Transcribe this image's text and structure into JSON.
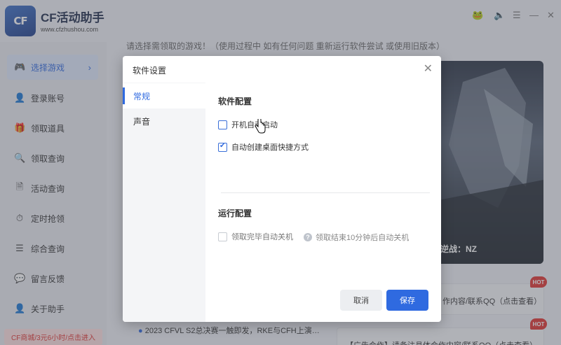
{
  "app": {
    "logo_text": "CF",
    "name": "CF活动助手",
    "url": "www.cfzhushou.com"
  },
  "window_controls": [
    "🐸",
    "🔈",
    "☰",
    "—",
    "✕"
  ],
  "sidebar": {
    "items": [
      {
        "label": "选择游戏",
        "icon": "gamepad-icon",
        "glyph": "🎮",
        "active": true
      },
      {
        "label": "登录账号",
        "icon": "user-icon",
        "glyph": "👤"
      },
      {
        "label": "领取道具",
        "icon": "gift-icon",
        "glyph": "🎁"
      },
      {
        "label": "领取查询",
        "icon": "search-gift-icon",
        "glyph": "🔍"
      },
      {
        "label": "活动查询",
        "icon": "document-search-icon",
        "glyph": "🗎"
      },
      {
        "label": "定时抢领",
        "icon": "timer-icon",
        "glyph": "⏱"
      },
      {
        "label": "综合查询",
        "icon": "list-icon",
        "glyph": "☰"
      },
      {
        "label": "留言反馈",
        "icon": "chat-icon",
        "glyph": "💬"
      },
      {
        "label": "关于助手",
        "icon": "info-user-icon",
        "glyph": "👤"
      }
    ],
    "promo": "CF商城/3元6小时/点击进入"
  },
  "main": {
    "notice": "请选择需领取的游戏！（使用过程中 如有任何问题 重新运行软件尝试 或使用旧版本）",
    "banner_title": "逆战：NZ",
    "news": [
      {
        "text": "作内容/联系QQ（点击查看）",
        "hot": "HOT"
      },
      {
        "text": "2023 CFVL S2总决赛一触即发，RKE与CFH上演…"
      },
      {
        "text": "【广告合作】请备注具体合作内容/联系QQ（点击查看）",
        "hot": "HOT"
      }
    ]
  },
  "dialog": {
    "title": "软件设置",
    "close_icon": "✕",
    "tabs": [
      "常规",
      "声音"
    ],
    "section_software": "软件配置",
    "opt_autostart": "开机自动启动",
    "opt_shortcut": "自动创建桌面快捷方式",
    "section_run": "运行配置",
    "opt_shutdown": "领取完毕自动关机",
    "hint": "领取结束10分钟后自动关机",
    "cancel": "取消",
    "save": "保存"
  },
  "colors": {
    "accent": "#2f6ae0",
    "hot_badge": "#e0322f",
    "promo_bg": "#ffe1e1"
  }
}
